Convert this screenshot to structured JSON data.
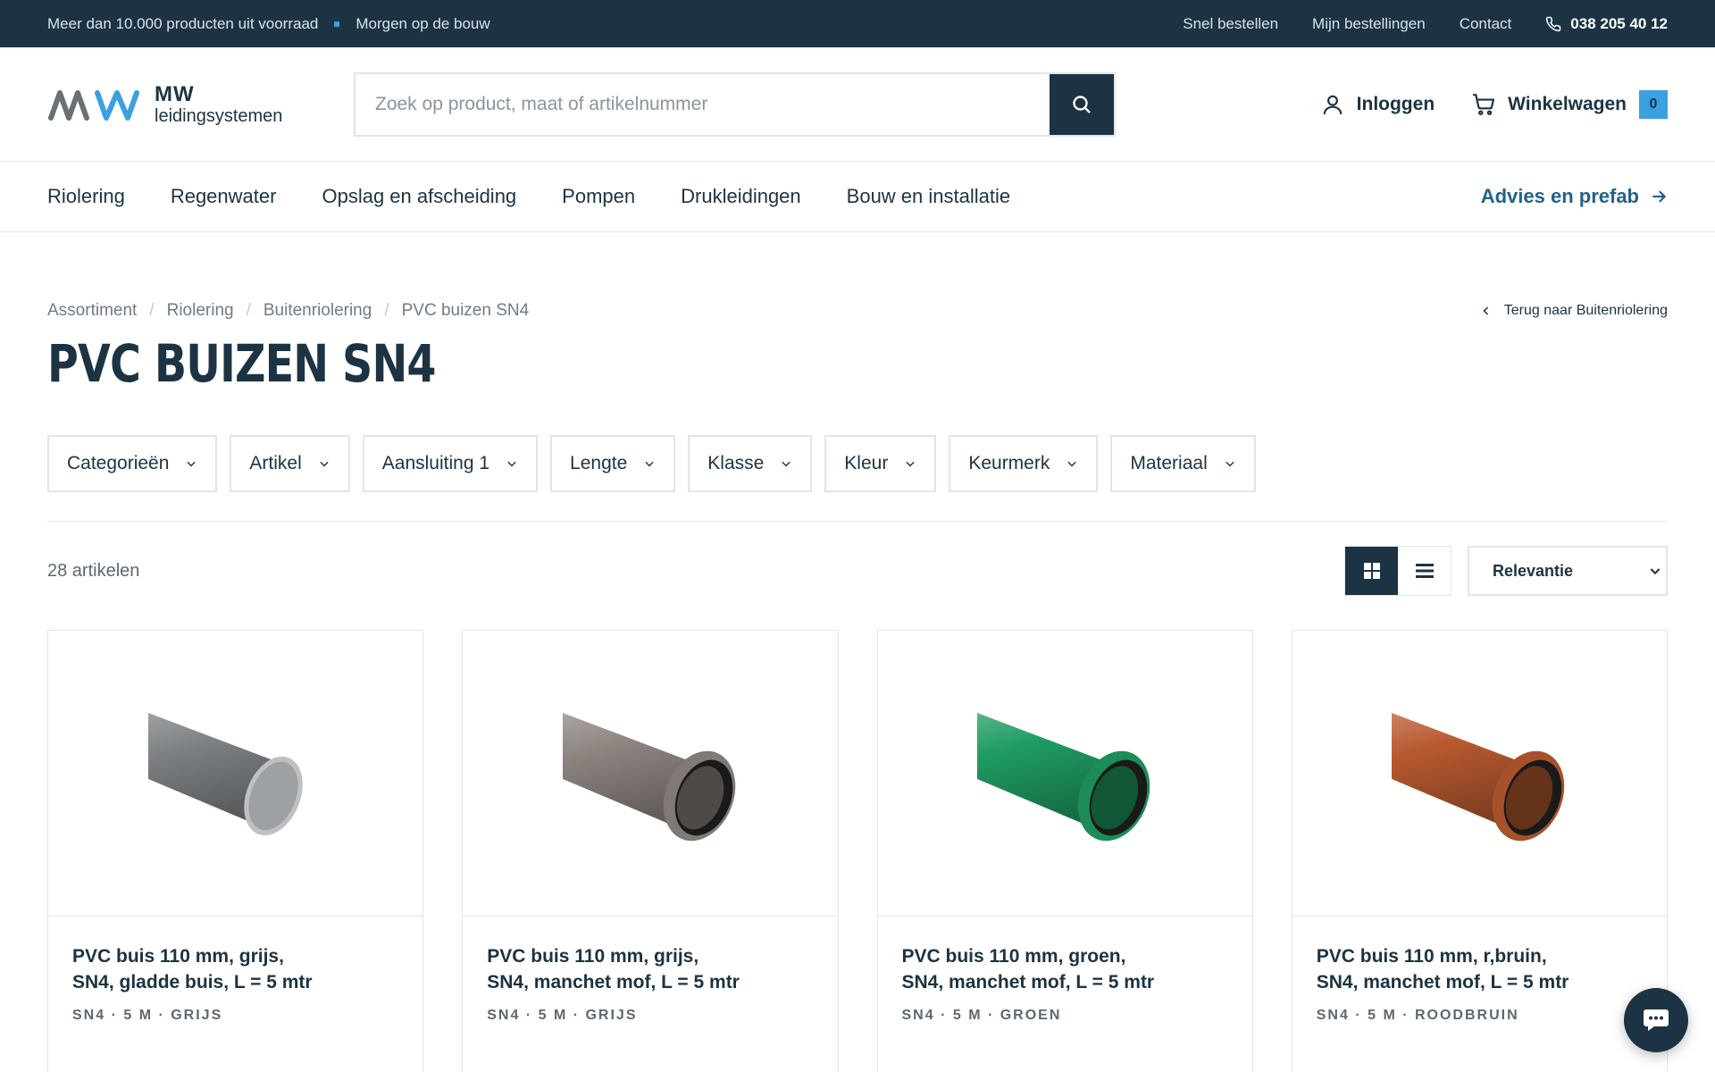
{
  "topbar": {
    "usp1": "Meer dan 10.000 producten uit voorraad",
    "usp2": "Morgen op de bouw",
    "links": [
      "Snel bestellen",
      "Mijn bestellingen",
      "Contact"
    ],
    "phone": "038 205 40 12"
  },
  "header": {
    "logo_top": "MW",
    "logo_bottom": "leidingsystemen",
    "search_placeholder": "Zoek op product, maat of artikelnummer",
    "login_label": "Inloggen",
    "cart_label": "Winkelwagen",
    "cart_count": "0"
  },
  "nav": {
    "items": [
      "Riolering",
      "Regenwater",
      "Opslag en afscheiding",
      "Pompen",
      "Drukleidingen",
      "Bouw en installatie"
    ],
    "advies": "Advies en prefab"
  },
  "breadcrumb": [
    "Assortiment",
    "Riolering",
    "Buitenriolering",
    "PVC buizen SN4"
  ],
  "back_link": "Terug naar Buitenriolering",
  "page_title": "PVC BUIZEN SN4",
  "filters": [
    "Categorieën",
    "Artikel",
    "Aansluiting 1",
    "Lengte",
    "Klasse",
    "Kleur",
    "Keurmerk",
    "Materiaal"
  ],
  "result_count": "28 artikelen",
  "sort": {
    "selected": "Relevantie"
  },
  "products": [
    {
      "name_line1": "PVC buis 110 mm, grijs,",
      "name_line2": "SN4, gladde buis, L = 5 mtr",
      "meta": "SN4 · 5 M · GRIJS",
      "color": "#7d8184",
      "socket": false
    },
    {
      "name_line1": "PVC buis 110 mm, grijs,",
      "name_line2": "SN4, manchet mof, L = 5 mtr",
      "meta": "SN4 · 5 M · GRIJS",
      "color": "#8f8682",
      "socket": true
    },
    {
      "name_line1": "PVC buis 110 mm, groen,",
      "name_line2": "SN4, manchet mof, L = 5 mtr",
      "meta": "SN4 · 5 M · GROEN",
      "color": "#1f9c63",
      "socket": true
    },
    {
      "name_line1": "PVC buis 110 mm, r,bruin,",
      "name_line2": "SN4, manchet mof, L = 5 mtr",
      "meta": "SN4 · 5 M · ROODBRUIN",
      "color": "#b85a30",
      "socket": true
    }
  ],
  "colors": {
    "primary": "#1c3343",
    "accent": "#3aa0e0",
    "link": "#21628a"
  }
}
